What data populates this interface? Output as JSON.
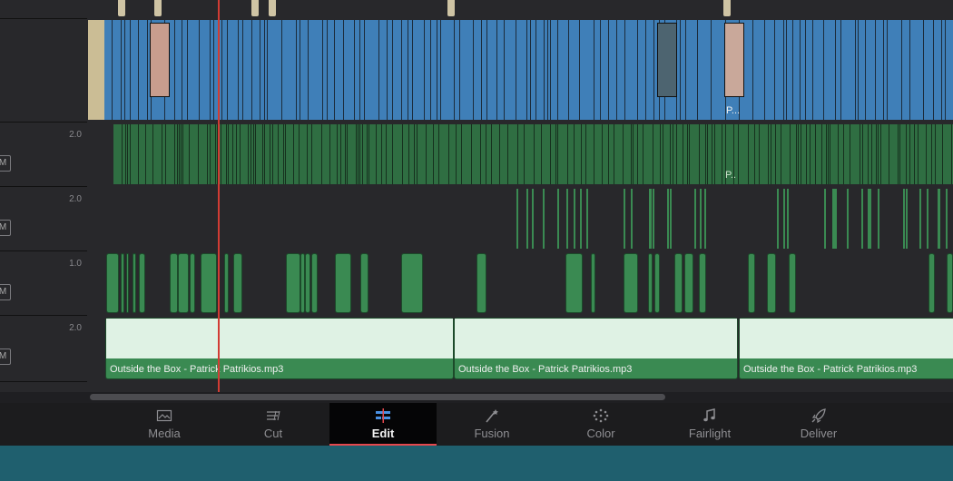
{
  "tracks": {
    "a1": {
      "volume": "2.0",
      "mute": "M"
    },
    "a2": {
      "volume": "2.0",
      "mute": "M"
    },
    "a3": {
      "volume": "1.0",
      "mute": "M"
    },
    "a4": {
      "volume": "2.0",
      "mute": "M"
    }
  },
  "video_clip_label": "P...",
  "audio_clip_label": "P..",
  "music_clips": [
    "Outside the Box - Patrick Patrikios.mp3",
    "Outside the Box - Patrick Patrikios.mp3",
    "Outside the Box - Patrick Patrikios.mp3"
  ],
  "pages": [
    {
      "label": "Media",
      "icon": "media-icon"
    },
    {
      "label": "Cut",
      "icon": "cut-icon"
    },
    {
      "label": "Edit",
      "icon": "edit-icon",
      "active": true
    },
    {
      "label": "Fusion",
      "icon": "fusion-icon"
    },
    {
      "label": "Color",
      "icon": "color-icon"
    },
    {
      "label": "Fairlight",
      "icon": "fairlight-icon"
    },
    {
      "label": "Deliver",
      "icon": "deliver-icon"
    }
  ]
}
